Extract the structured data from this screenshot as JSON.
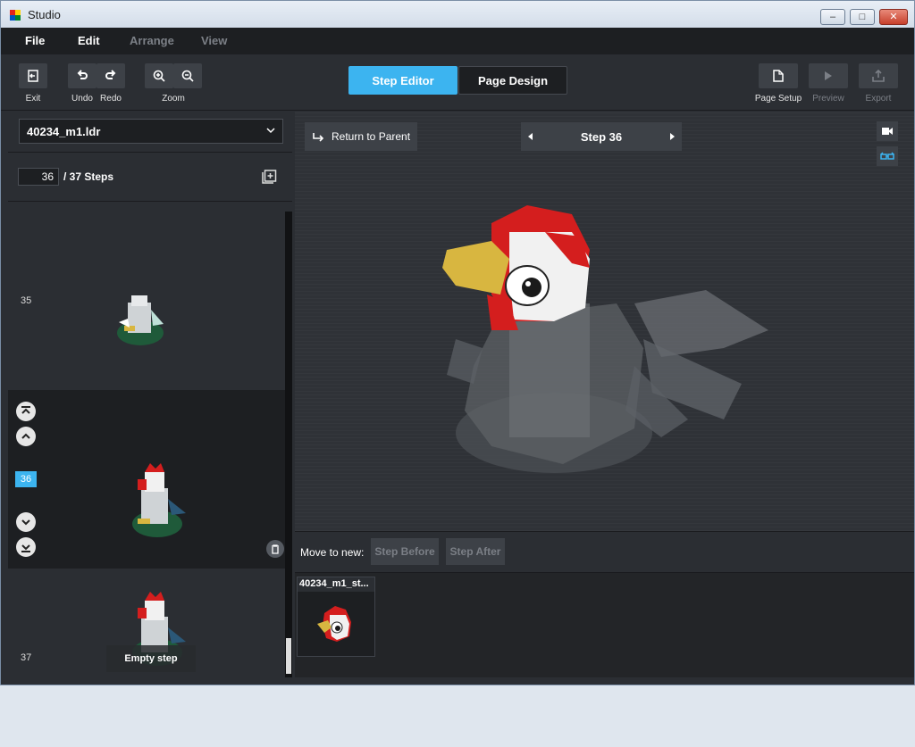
{
  "window": {
    "title": "Studio",
    "controls": {
      "minimize": "–",
      "maximize": "□",
      "close": "✕"
    }
  },
  "menu": {
    "file": "File",
    "edit": "Edit",
    "arrange": "Arrange",
    "view": "View"
  },
  "toolbar": {
    "exit": "Exit",
    "undo": "Undo",
    "redo": "Redo",
    "zoom": "Zoom",
    "step_editor": "Step Editor",
    "page_design": "Page Design",
    "page_setup": "Page Setup",
    "preview": "Preview",
    "export": "Export"
  },
  "left": {
    "file_name": "40234_m1.ldr",
    "current_step": "36",
    "steps_total": "/ 37 Steps",
    "steps": [
      {
        "num": "35"
      },
      {
        "num": "36"
      },
      {
        "num": "37",
        "empty_label": "Empty step"
      }
    ]
  },
  "main": {
    "return_label": "Return to Parent",
    "step_title": "Step 36",
    "move_label": "Move to new:",
    "step_before": "Step Before",
    "step_after": "Step After",
    "page_thumb_title": "40234_m1_st..."
  },
  "colors": {
    "accent": "#3cb4f0",
    "panel": "#2b2e33",
    "dark": "#1d1f22"
  }
}
